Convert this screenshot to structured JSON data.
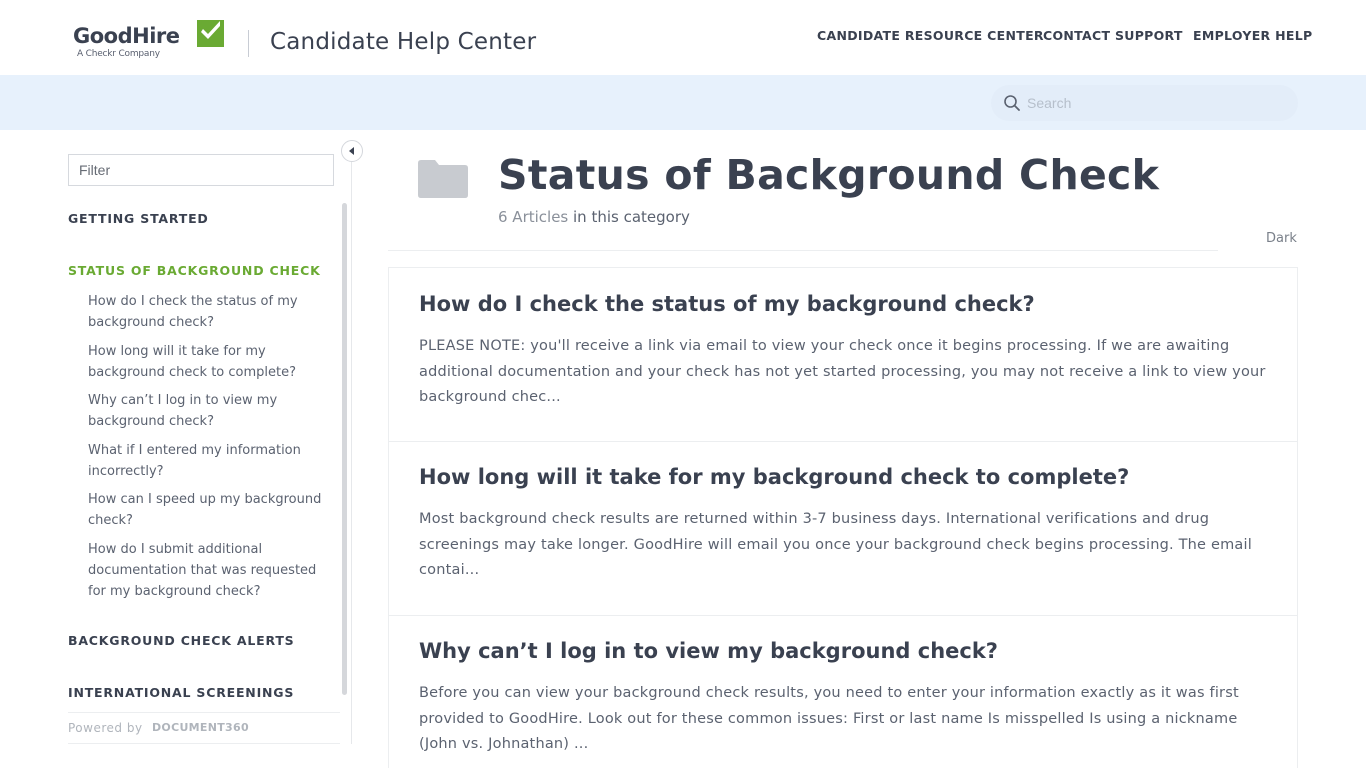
{
  "header": {
    "logo_word": "GoodHire",
    "logo_sub": "A Checkr Company",
    "site_title": "Candidate Help Center",
    "nav": [
      "CANDIDATE RESOURCE CENTER",
      "CONTACT SUPPORT",
      "EMPLOYER HELP"
    ],
    "brand_green": "#6aaa33"
  },
  "search": {
    "placeholder": "Search"
  },
  "sidebar": {
    "filter_placeholder": "Filter",
    "categories": [
      {
        "label": "GETTING STARTED"
      },
      {
        "label": "STATUS OF BACKGROUND CHECK",
        "active": true,
        "articles": [
          "How do I check the status of my background check?",
          "How long will it take for my background check to complete?",
          "Why can’t I log in to view my background check?",
          "What if I entered my information incorrectly?",
          "How can I speed up my background check?",
          "How do I submit additional documentation that was requested for my background check?"
        ]
      },
      {
        "label": "BACKGROUND CHECK ALERTS"
      },
      {
        "label": "INTERNATIONAL SCREENINGS"
      }
    ],
    "powered_by_label": "Powered by",
    "powered_by_brand": "DOCUMENT360"
  },
  "main": {
    "title": "Status of Background Check",
    "count_number": "6 Articles",
    "count_suffix": " in this category",
    "theme_toggle": "Dark",
    "articles": [
      {
        "title": "How do I check the status of my background check?",
        "excerpt": "PLEASE NOTE: you'll receive a link via email to view your check once it begins processing. If we are awaiting additional documentation and your check has not yet started processing, you may not receive a link to view your background chec..."
      },
      {
        "title": "How long will it take for my background check to complete?",
        "excerpt": "Most background check results are returned within 3-7 business days. International verifications and drug screenings may take longer. GoodHire will email you once your background check begins processing. The email contai..."
      },
      {
        "title": "Why can’t I log in to view my background check?",
        "excerpt": "Before you can view your background check results, you need to enter your information exactly as it was first provided to GoodHire. Look out for these common issues: First or last name Is misspelled Is using a nickname (John vs. Johnathan) ..."
      }
    ]
  }
}
